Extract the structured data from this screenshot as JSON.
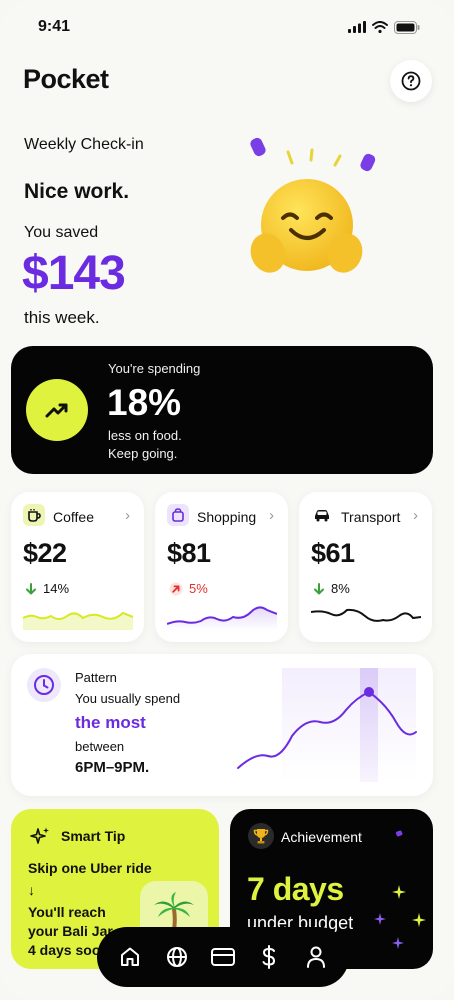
{
  "status_bar": {
    "time": "9:41"
  },
  "header": {
    "title": "Pocket"
  },
  "checkin": {
    "label": "Weekly Check-in",
    "headline": "Nice work.",
    "saved_label": "You saved",
    "amount": "$143",
    "period": "this week."
  },
  "spending_card": {
    "title": "You're spending",
    "percent": "18%",
    "line1": "less on food.",
    "line2": "Keep going."
  },
  "categories": [
    {
      "name": "Coffee",
      "amount": "$22",
      "trend": "14%",
      "direction": "down",
      "color": "#dff23e"
    },
    {
      "name": "Shopping",
      "amount": "$81",
      "trend": "5%",
      "direction": "up",
      "color": "#6b2be0"
    },
    {
      "name": "Transport",
      "amount": "$61",
      "trend": "8%",
      "direction": "down",
      "color": "#111111"
    }
  ],
  "pattern": {
    "title": "Pattern",
    "line1": "You usually spend",
    "emphasis": "the most",
    "line2": "between",
    "time_range": "6PM–9PM."
  },
  "smart_tip": {
    "title": "Smart Tip",
    "line1": "Skip one Uber ride",
    "arrow": "↓",
    "line2": "You'll reach",
    "line3": "your Bali Jar",
    "line4": "4 days sooner"
  },
  "achievement": {
    "title": "Achievement",
    "value": "7 days",
    "subtitle": "under budget"
  },
  "nav": {
    "items": [
      "home-icon",
      "globe-icon",
      "card-icon",
      "dollar-icon",
      "profile-icon"
    ]
  },
  "colors": {
    "accent_purple": "#6b2be0",
    "accent_lime": "#dff23e",
    "dark": "#050505",
    "down_green": "#3aa13a",
    "up_red": "#e0322f"
  }
}
